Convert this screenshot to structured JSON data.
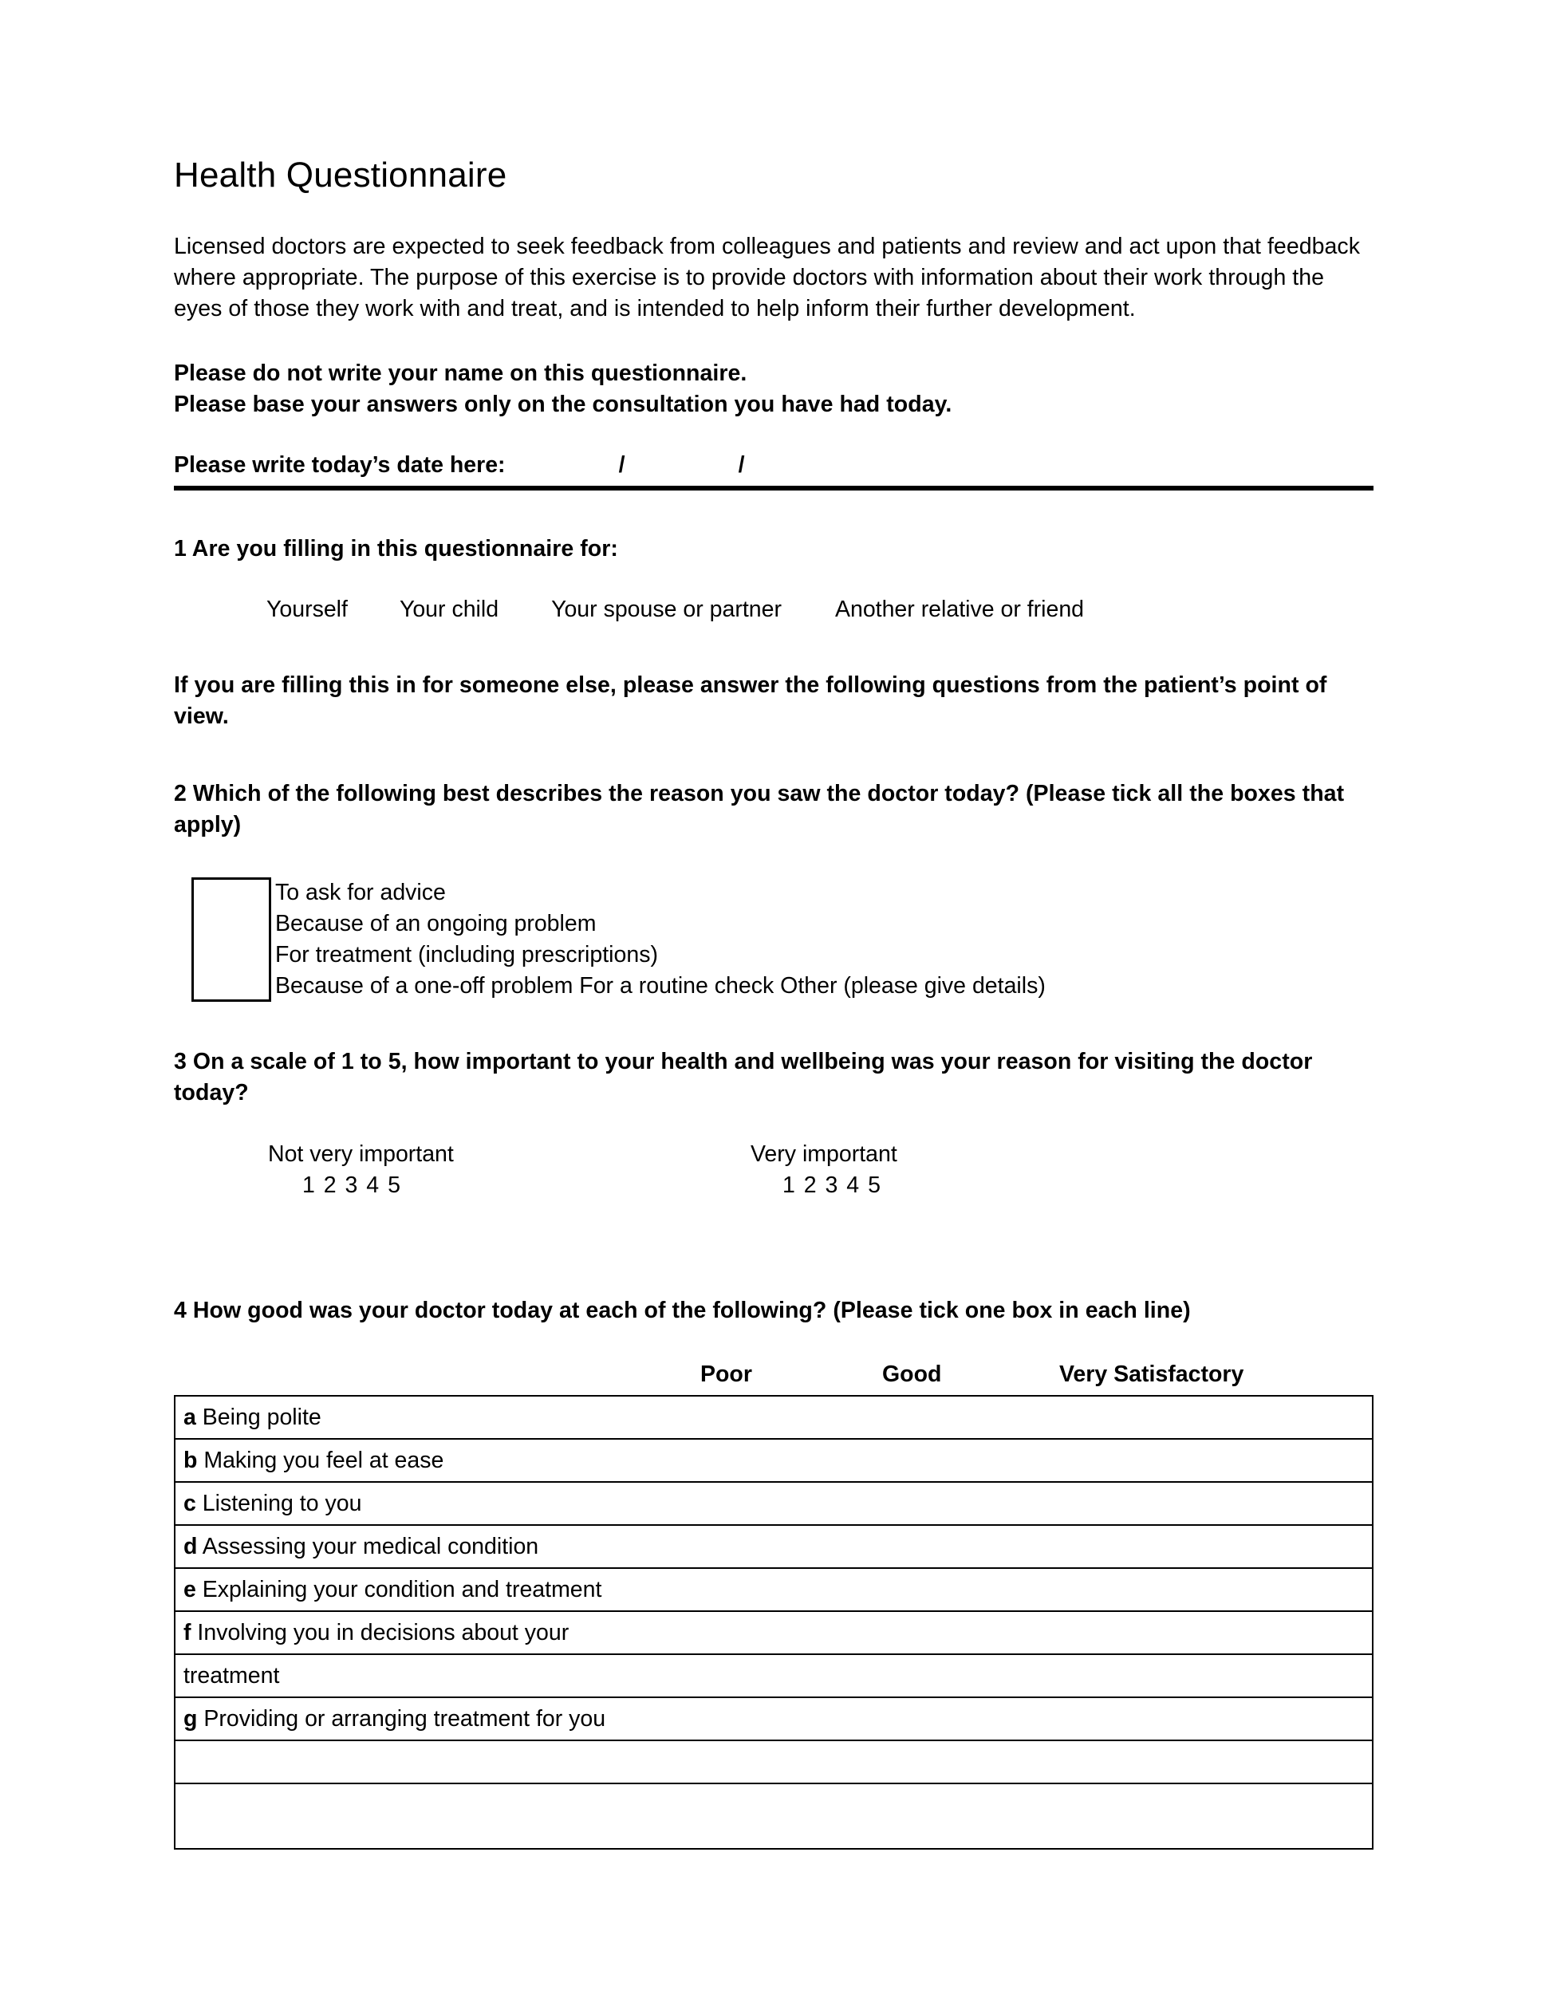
{
  "document": {
    "title": "Health Questionnaire",
    "intro_paragraph": "Licensed doctors are expected to seek feedback from colleagues and patients and review and act upon that feedback where appropriate. The purpose of this exercise is to provide doctors with information about their work through the eyes of those they work with and treat, and is intended to help inform their further development.",
    "instruction_line_1": "Please do not write your name on this questionnaire.",
    "instruction_line_2": "Please base your answers only on the consultation you have had today.",
    "date_prompt": {
      "label": "Please write today’s date here:",
      "separator_1": "/",
      "separator_2": "/"
    }
  },
  "question1": {
    "text": "1 Are you filling in this questionnaire for:",
    "options": [
      "Yourself",
      "Your child",
      "Your spouse or partner",
      "Another relative or friend"
    ],
    "note": "If you are filling this in for someone else, please answer the following questions from the patient’s point of view."
  },
  "question2": {
    "text": "2 Which of the following best describes the reason you saw the doctor today? (Please tick all the boxes that apply)",
    "options": [
      "To ask for advice",
      "Because of an ongoing problem",
      "For treatment (including prescriptions)",
      "Because of a one-off problem For a routine check Other (please give details)"
    ]
  },
  "question3": {
    "text": "3 On a scale of 1 to 5, how important to your health and wellbeing was your reason for visiting the doctor today?",
    "scale_left_label": "Not very important",
    "scale_left_numbers": "1 2 3 4 5",
    "scale_right_label": "Very important",
    "scale_right_numbers": "1 2 3 4 5"
  },
  "question4": {
    "text": "4 How good was your doctor today at each of the following? (Please tick one box in each line)",
    "column_headers": [
      "Poor",
      "Good",
      "Very Satisfactory"
    ],
    "rows": [
      {
        "letter": "a",
        "label": "Being polite"
      },
      {
        "letter": "b",
        "label": "Making you feel at ease"
      },
      {
        "letter": "c",
        "label": "Listening to you"
      },
      {
        "letter": "d",
        "label": "Assessing your medical condition"
      },
      {
        "letter": "e",
        "label": "Explaining your condition and treatment"
      },
      {
        "letter": "f",
        "label": "Involving you in decisions about your"
      },
      {
        "letter": "",
        "label": "treatment"
      },
      {
        "letter": "g",
        "label": "Providing or arranging treatment for you"
      },
      {
        "letter": "",
        "label": ""
      },
      {
        "letter": "",
        "label": ""
      }
    ]
  }
}
